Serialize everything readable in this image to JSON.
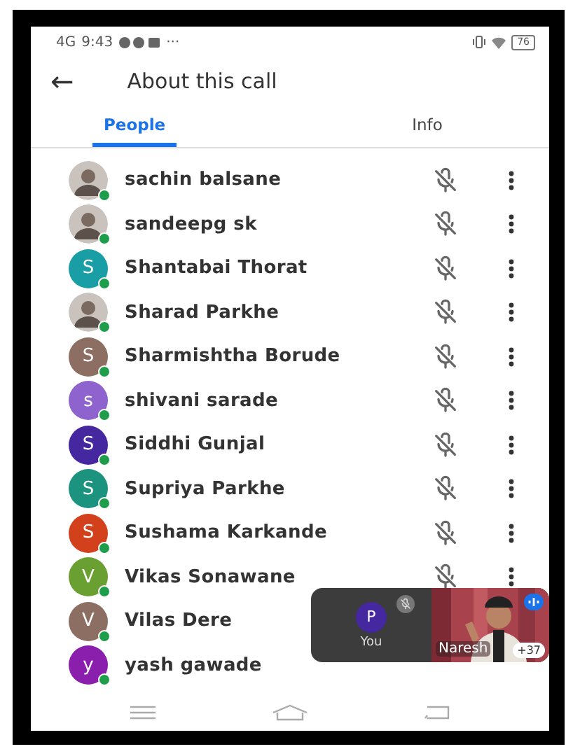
{
  "status_bar": {
    "network": "4G",
    "time": "9:43",
    "more": "···",
    "battery": "76"
  },
  "header": {
    "back": "←",
    "title": "About this call"
  },
  "tabs": [
    {
      "label": "People",
      "selected": true
    },
    {
      "label": "Info",
      "selected": false
    }
  ],
  "people": [
    {
      "name": "sachin balsane",
      "muted": true
    },
    {
      "name": "sandeepg sk",
      "muted": true
    },
    {
      "name": "Shantabai Thorat",
      "kind": "letter",
      "initial": "S",
      "color": "#1a9ea6",
      "muted": true
    },
    {
      "name": "Sharad Parkhe",
      "muted": true
    },
    {
      "name": "Sharmishtha Borude",
      "kind": "letter",
      "initial": "S",
      "color": "#8d6e63",
      "muted": true
    },
    {
      "name": "shivani sarade",
      "kind": "letter",
      "initial": "s",
      "color": "#8e63ce",
      "muted": true
    },
    {
      "name": "Siddhi Gunjal",
      "kind": "letter",
      "initial": "S",
      "color": "#4527a0",
      "muted": true
    },
    {
      "name": "Supriya Parkhe",
      "kind": "letter",
      "initial": "S",
      "color": "#1b937f",
      "muted": true
    },
    {
      "name": "Sushama Karkande",
      "kind": "letter",
      "initial": "S",
      "color": "#d2401c",
      "muted": true
    },
    {
      "name": "Vikas Sonawane",
      "kind": "letter",
      "initial": "V",
      "color": "#6a9f32",
      "muted": true
    },
    {
      "name": "Vilas Dere",
      "kind": "letter",
      "initial": "V",
      "color": "#8d6e63"
    },
    {
      "name": "yash gawade",
      "kind": "letter",
      "initial": "y",
      "color": "#8a1fae"
    }
  ],
  "self_view": {
    "initial": "P",
    "label": "You",
    "muted": true
  },
  "speaker": {
    "kind": "picture",
    "name": "Naresh",
    "others": "+37"
  }
}
